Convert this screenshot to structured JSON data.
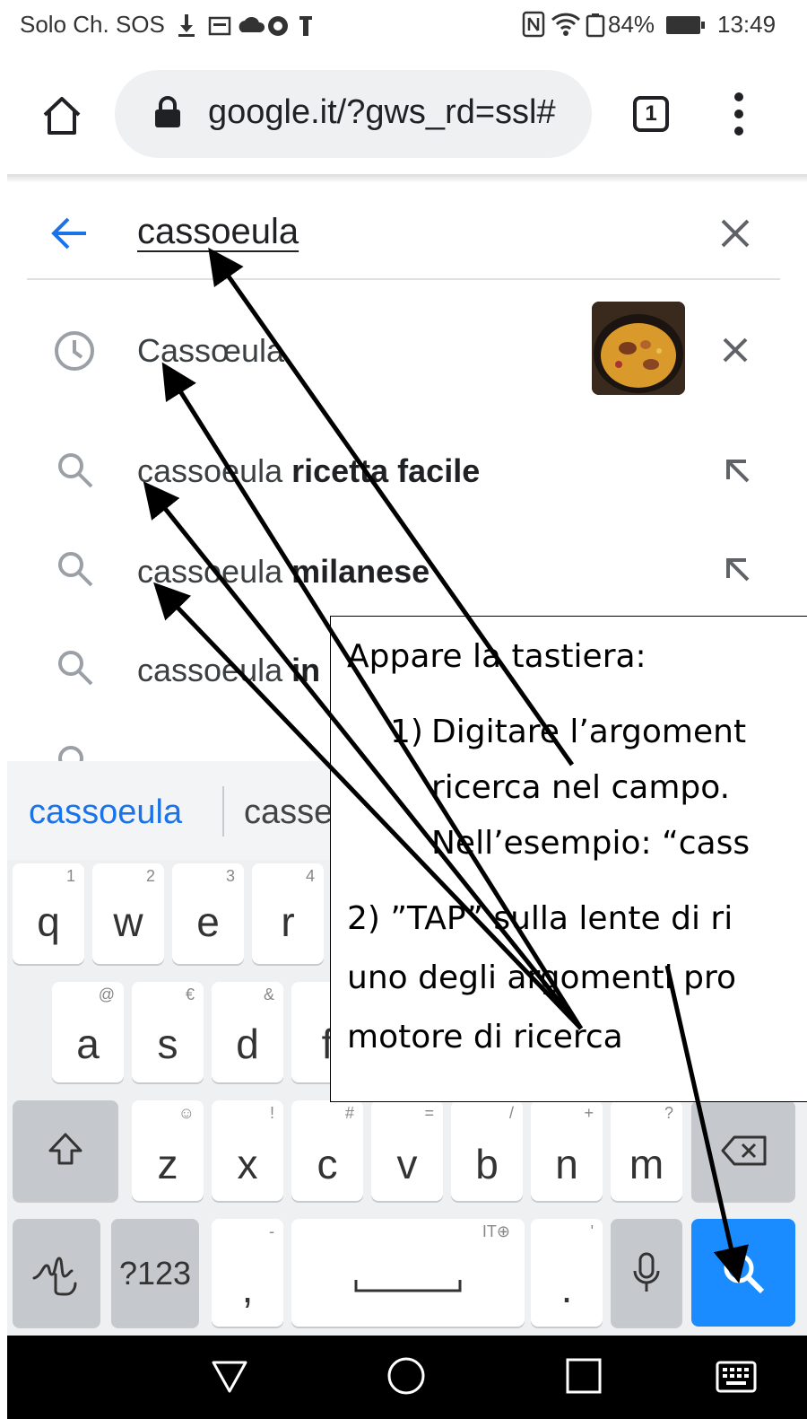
{
  "status_bar": {
    "carrier": "Solo Ch. SOS",
    "battery": "84%",
    "time": "13:49"
  },
  "browser": {
    "url": "google.it/?gws_rd=ssl#",
    "tab_count": "1"
  },
  "search": {
    "query": "cassoeula"
  },
  "suggestions": [
    {
      "icon": "clock-icon",
      "base": "Cassœula",
      "bold": "",
      "action": "remove"
    },
    {
      "icon": "search-icon",
      "base": "cassoeula ",
      "bold": "ricetta facile",
      "action": "fill"
    },
    {
      "icon": "search-icon",
      "base": "cassoeula ",
      "bold": "milanese",
      "action": "fill"
    },
    {
      "icon": "search-icon",
      "base": "cassoeula ",
      "bold": "in",
      "action": "fill"
    }
  ],
  "keyboard": {
    "word_suggestions": [
      "cassoeula",
      "casse"
    ],
    "row1": [
      {
        "k": "q",
        "s": "1"
      },
      {
        "k": "w",
        "s": "2"
      },
      {
        "k": "e",
        "s": "3"
      },
      {
        "k": "r",
        "s": "4"
      }
    ],
    "row2": [
      {
        "k": "a",
        "s": "@"
      },
      {
        "k": "s",
        "s": "€"
      },
      {
        "k": "d",
        "s": "&"
      },
      {
        "k": "f",
        "s": ""
      }
    ],
    "row3": [
      {
        "k": "z",
        "s": "☺"
      },
      {
        "k": "x",
        "s": "!"
      },
      {
        "k": "c",
        "s": "#"
      },
      {
        "k": "v",
        "s": "="
      },
      {
        "k": "b",
        "s": "/"
      },
      {
        "k": "n",
        "s": "+"
      },
      {
        "k": "m",
        "s": "?"
      }
    ],
    "symbols_key": "?123",
    "comma": ",",
    "comma_sup": "-",
    "space_sup": "IT⊕",
    "period": ".",
    "period_sup": "'"
  },
  "annotation": {
    "line1": "Appare la tastiera:",
    "item1_num": "1)",
    "item1_line1": "Digitare l’argoment",
    "item1_line2": "ricerca nel campo.",
    "item1_line3": "Nell’esempio: “cass",
    "item2_line1": "2) ”TAP” sulla lente di ri",
    "item2_line2": "uno degli argomenti pro",
    "item2_line3": "motore di ricerca"
  },
  "colors": {
    "accent_blue": "#1a73e8",
    "search_key": "#1a8cff"
  }
}
